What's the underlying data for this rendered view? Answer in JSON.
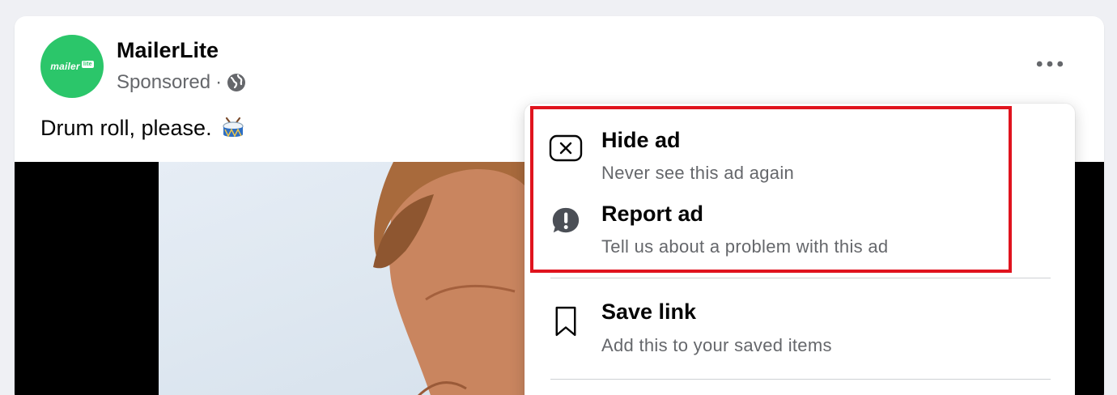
{
  "post": {
    "page_name": "MailerLite",
    "avatar_logo_text": "mailer",
    "avatar_logo_tag": "lite",
    "sponsored_label": "Sponsored",
    "separator": "·",
    "text": "Drum roll, please.",
    "more_icon": "more-horizontal-icon",
    "privacy_icon": "globe-icon",
    "emoji_icon": "drum-icon"
  },
  "menu": {
    "items": [
      {
        "title": "Hide ad",
        "subtitle": "Never see this ad again",
        "icon": "hide-x-icon"
      },
      {
        "title": "Report ad",
        "subtitle": "Tell us about a problem with this ad",
        "icon": "report-exclamation-icon"
      },
      {
        "title": "Save link",
        "subtitle": "Add this to your saved items",
        "icon": "bookmark-icon"
      }
    ]
  },
  "colors": {
    "brand_green": "#2bc66a",
    "highlight_red": "#e0141e",
    "text_primary": "#050505",
    "text_secondary": "#65676b"
  }
}
